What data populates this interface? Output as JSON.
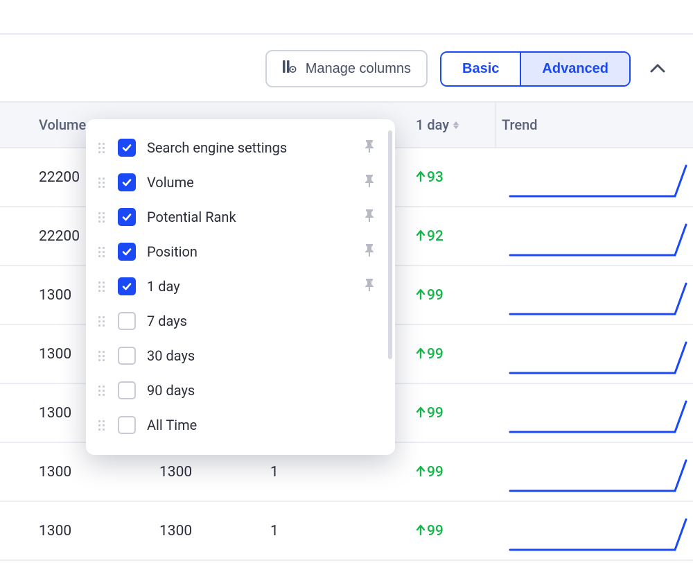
{
  "toolbar": {
    "manage_columns_label": "Manage columns",
    "basic_label": "Basic",
    "advanced_label": "Advanced"
  },
  "columns": {
    "volume": "Volume",
    "one_day": "1 day",
    "trend": "Trend"
  },
  "dropdown": {
    "items": [
      {
        "label": "Search engine settings",
        "checked": true,
        "pinned": true
      },
      {
        "label": "Volume",
        "checked": true,
        "pinned": true
      },
      {
        "label": "Potential Rank",
        "checked": true,
        "pinned": true
      },
      {
        "label": "Position",
        "checked": true,
        "pinned": true
      },
      {
        "label": "1 day",
        "checked": true,
        "pinned": true
      },
      {
        "label": "7 days",
        "checked": false,
        "pinned": false
      },
      {
        "label": "30 days",
        "checked": false,
        "pinned": false
      },
      {
        "label": "90 days",
        "checked": false,
        "pinned": false
      },
      {
        "label": "All Time",
        "checked": false,
        "pinned": false
      }
    ]
  },
  "rows": [
    {
      "volume": "22200",
      "pr": "",
      "pos": "",
      "delta": "93"
    },
    {
      "volume": "22200",
      "pr": "",
      "pos": "",
      "delta": "92"
    },
    {
      "volume": "1300",
      "pr": "",
      "pos": "",
      "delta": "99"
    },
    {
      "volume": "1300",
      "pr": "",
      "pos": "",
      "delta": "99"
    },
    {
      "volume": "1300",
      "pr": "",
      "pos": "",
      "delta": "99"
    },
    {
      "volume": "1300",
      "pr": "1300",
      "pos": "1",
      "delta": "99"
    },
    {
      "volume": "1300",
      "pr": "1300",
      "pos": "1",
      "delta": "99"
    }
  ]
}
